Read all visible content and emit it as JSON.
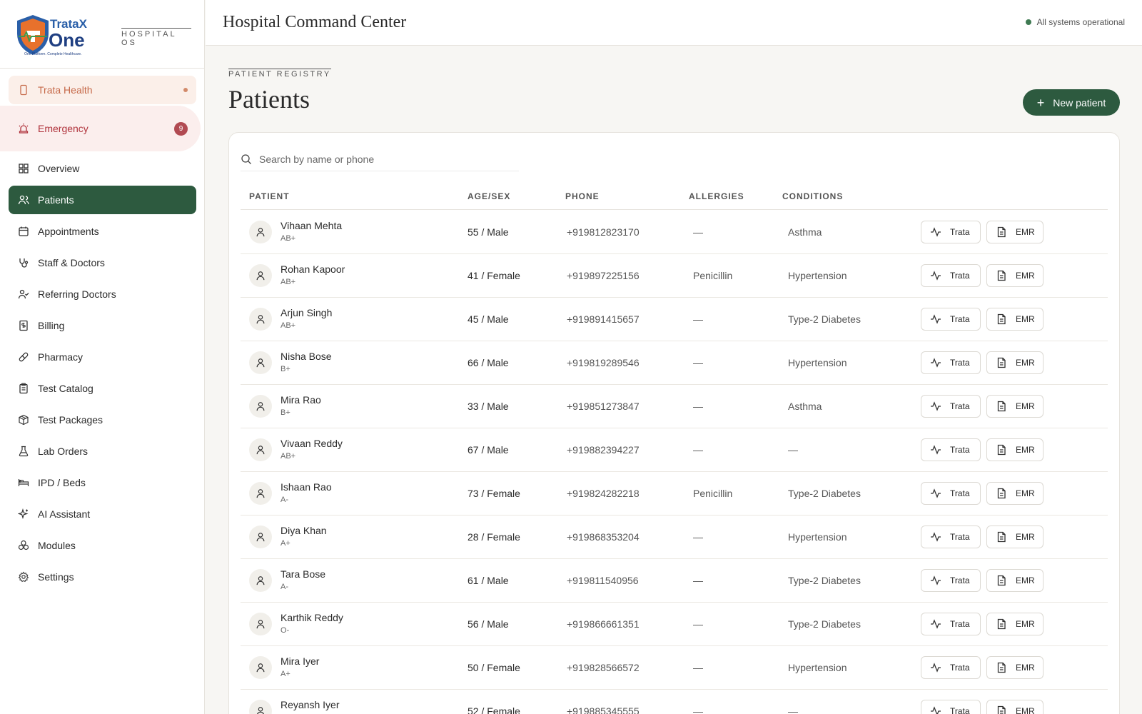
{
  "brand": {
    "os_label": "HOSPITAL OS"
  },
  "sidebar": {
    "trata": {
      "label": "Trata Health"
    },
    "emergency": {
      "label": "Emergency",
      "badge": "9"
    },
    "items": [
      {
        "label": "Overview",
        "icon": "grid-icon"
      },
      {
        "label": "Patients",
        "icon": "users-icon",
        "active": true
      },
      {
        "label": "Appointments",
        "icon": "calendar-icon"
      },
      {
        "label": "Staff & Doctors",
        "icon": "stethoscope-icon"
      },
      {
        "label": "Referring Doctors",
        "icon": "user-check-icon"
      },
      {
        "label": "Billing",
        "icon": "receipt-icon"
      },
      {
        "label": "Pharmacy",
        "icon": "pill-icon"
      },
      {
        "label": "Test Catalog",
        "icon": "clipboard-icon"
      },
      {
        "label": "Test Packages",
        "icon": "package-icon"
      },
      {
        "label": "Lab Orders",
        "icon": "flask-icon"
      },
      {
        "label": "IPD / Beds",
        "icon": "bed-icon"
      },
      {
        "label": "AI Assistant",
        "icon": "sparkles-icon"
      },
      {
        "label": "Modules",
        "icon": "boxes-icon"
      },
      {
        "label": "Settings",
        "icon": "gear-icon"
      }
    ]
  },
  "header": {
    "title": "Hospital Command Center",
    "status": "All systems operational"
  },
  "main": {
    "eyebrow": "PATIENT REGISTRY",
    "title": "Patients",
    "new_button": "New patient",
    "search_placeholder": "Search by name or phone"
  },
  "table": {
    "columns": [
      "PATIENT",
      "AGE/SEX",
      "PHONE",
      "ALLERGIES",
      "CONDITIONS"
    ],
    "trata_label": "Trata",
    "emr_label": "EMR",
    "rows": [
      {
        "name": "Vihaan Mehta",
        "blood": "AB+",
        "age_sex": "55 / Male",
        "phone": "+919812823170",
        "allergies": "—",
        "conditions": "Asthma"
      },
      {
        "name": "Rohan Kapoor",
        "blood": "AB+",
        "age_sex": "41 / Female",
        "phone": "+919897225156",
        "allergies": "Penicillin",
        "conditions": "Hypertension"
      },
      {
        "name": "Arjun Singh",
        "blood": "AB+",
        "age_sex": "45 / Male",
        "phone": "+919891415657",
        "allergies": "—",
        "conditions": "Type-2 Diabetes"
      },
      {
        "name": "Nisha Bose",
        "blood": "B+",
        "age_sex": "66 / Male",
        "phone": "+919819289546",
        "allergies": "—",
        "conditions": "Hypertension"
      },
      {
        "name": "Mira Rao",
        "blood": "B+",
        "age_sex": "33 / Male",
        "phone": "+919851273847",
        "allergies": "—",
        "conditions": "Asthma"
      },
      {
        "name": "Vivaan Reddy",
        "blood": "AB+",
        "age_sex": "67 / Male",
        "phone": "+919882394227",
        "allergies": "—",
        "conditions": "—"
      },
      {
        "name": "Ishaan Rao",
        "blood": "A-",
        "age_sex": "73 / Female",
        "phone": "+919824282218",
        "allergies": "Penicillin",
        "conditions": "Type-2 Diabetes"
      },
      {
        "name": "Diya Khan",
        "blood": "A+",
        "age_sex": "28 / Female",
        "phone": "+919868353204",
        "allergies": "—",
        "conditions": "Hypertension"
      },
      {
        "name": "Tara Bose",
        "blood": "A-",
        "age_sex": "61 / Male",
        "phone": "+919811540956",
        "allergies": "—",
        "conditions": "Type-2 Diabetes"
      },
      {
        "name": "Karthik Reddy",
        "blood": "O-",
        "age_sex": "56 / Male",
        "phone": "+919866661351",
        "allergies": "—",
        "conditions": "Type-2 Diabetes"
      },
      {
        "name": "Mira Iyer",
        "blood": "A+",
        "age_sex": "50 / Female",
        "phone": "+919828566572",
        "allergies": "—",
        "conditions": "Hypertension"
      },
      {
        "name": "Reyansh Iyer",
        "blood": "",
        "age_sex": "52 / Female",
        "phone": "+919885345555",
        "allergies": "—",
        "conditions": "—"
      }
    ]
  },
  "colors": {
    "primary": "#2d5a3f",
    "emergency": "#b0333c",
    "trata": "#c66a4a"
  }
}
